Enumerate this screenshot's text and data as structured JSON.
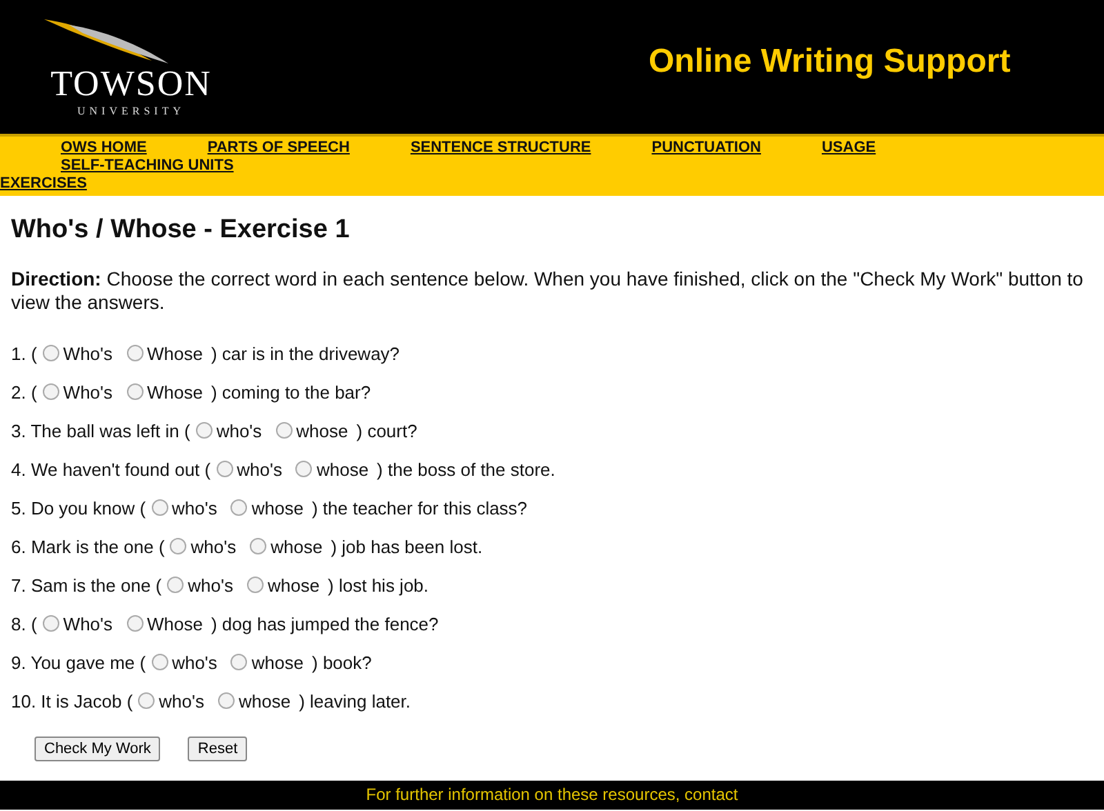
{
  "header": {
    "logo_name": "TOWSON",
    "logo_sub": "UNIVERSITY",
    "site_title": "Online Writing Support"
  },
  "nav": [
    "OWS HOME",
    "PARTS OF SPEECH",
    "SENTENCE STRUCTURE",
    "PUNCTUATION",
    "USAGE",
    "SELF-TEACHING UNITS",
    "EXERCISES"
  ],
  "title": "Who's / Whose - Exercise 1",
  "direction": "**Direction:** Choose the correct word in each sentence below. When you have finished, click on the \"Check My Work\" button to view the answers.",
  "questions": [
    {
      "before": "1. (",
      "options": [
        {
          "label": "Who's",
          "selected": false
        },
        {
          "label": "Whose",
          "selected": false
        }
      ],
      "after": ") car is in the driveway?"
    },
    {
      "before": "2. (",
      "options": [
        {
          "label": "Who's",
          "selected": false
        },
        {
          "label": "Whose",
          "selected": false
        }
      ],
      "after": ") coming to the bar?"
    },
    {
      "before": "3. The ball was left in (",
      "options": [
        {
          "label": "who's",
          "selected": false
        },
        {
          "label": "whose",
          "selected": false
        }
      ],
      "after": ") court?"
    },
    {
      "before": "4. We haven't found out (",
      "options": [
        {
          "label": "who's",
          "selected": false
        },
        {
          "label": "whose",
          "selected": false
        }
      ],
      "after": ") the boss of the store."
    },
    {
      "before": "5. Do you know (",
      "options": [
        {
          "label": "who's",
          "selected": false
        },
        {
          "label": "whose",
          "selected": false
        }
      ],
      "after": ") the teacher for this class?"
    },
    {
      "before": "6. Mark is the one (",
      "options": [
        {
          "label": "who's",
          "selected": false
        },
        {
          "label": "whose",
          "selected": false
        }
      ],
      "after": ") job has been lost."
    },
    {
      "before": "7. Sam is the one (",
      "options": [
        {
          "label": "who's",
          "selected": false
        },
        {
          "label": "whose",
          "selected": false
        }
      ],
      "after": ") lost his job."
    },
    {
      "before": "8. (",
      "options": [
        {
          "label": "Who's",
          "selected": false
        },
        {
          "label": "Whose",
          "selected": false
        }
      ],
      "after": ") dog has jumped the fence?"
    },
    {
      "before": "9. You gave me (",
      "options": [
        {
          "label": "who's",
          "selected": false
        },
        {
          "label": "whose",
          "selected": false
        }
      ],
      "after": ") book?"
    },
    {
      "before": "10. It is Jacob (",
      "options": [
        {
          "label": "who's",
          "selected": false
        },
        {
          "label": "whose",
          "selected": false
        }
      ],
      "after": ") leaving later."
    }
  ],
  "buttons": [
    "Check My Work",
    "Reset"
  ],
  "footer": "For further information on these resources, contact"
}
